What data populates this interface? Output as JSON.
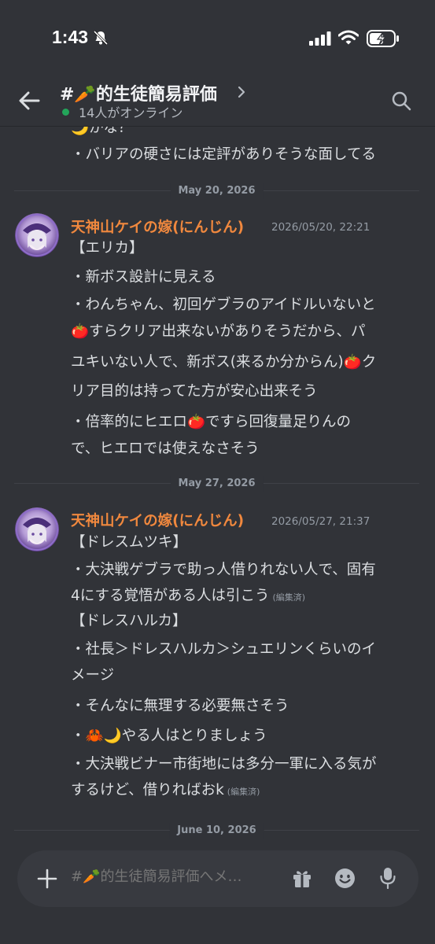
{
  "status_bar": {
    "time": "1:43"
  },
  "header": {
    "channel_title": "#🥕的生徒簡易評価",
    "online_text": "14人がオンライン"
  },
  "chat": {
    "top_fragment": [
      "🌙かな？",
      "・バリアの硬さには定評がありそうな面してる"
    ],
    "date_dividers": [
      "May 20, 2026",
      "May 27, 2026",
      "June 10, 2026"
    ],
    "messages": [
      {
        "author": "天神山ケイの嫁(にんじん)",
        "timestamp": "2026/05/20, 22:21",
        "lines": [
          "【エリカ】",
          "・新ボス設計に見える",
          "・わんちゃん、初回ゲブラのアイドルいないと",
          "🍅すらクリア出来ないがありそうだから、パ",
          "ユキいない人で、新ボス(来るか分からん)🍅ク",
          "リア目的は持ってた方が安心出来そう",
          "・倍率的にヒエロ🍅ですら回復量足りんの",
          "で、ヒエロでは使えなさそう"
        ]
      },
      {
        "author": "天神山ケイの嫁(にんじん)",
        "timestamp": "2026/05/27, 21:37",
        "lines": [
          "【ドレスムツキ】",
          "・大決戦ゲブラで助っ人借りれない人で、固有",
          "4にする覚悟がある人は引こう",
          "【ドレスハルカ】",
          "・社長＞ドレスハルカ＞シュエリンくらいのイ",
          "メージ",
          "・そんなに無理する必要無さそう",
          "・🦀🌙やる人はとりましょう",
          "・大決戦ビナー市街地には多分一軍に入る気が",
          "するけど、借りればおk"
        ],
        "edited_label": "(編集済)"
      }
    ]
  },
  "composer": {
    "placeholder": "#🥕的生徒簡易評価へメ…"
  }
}
